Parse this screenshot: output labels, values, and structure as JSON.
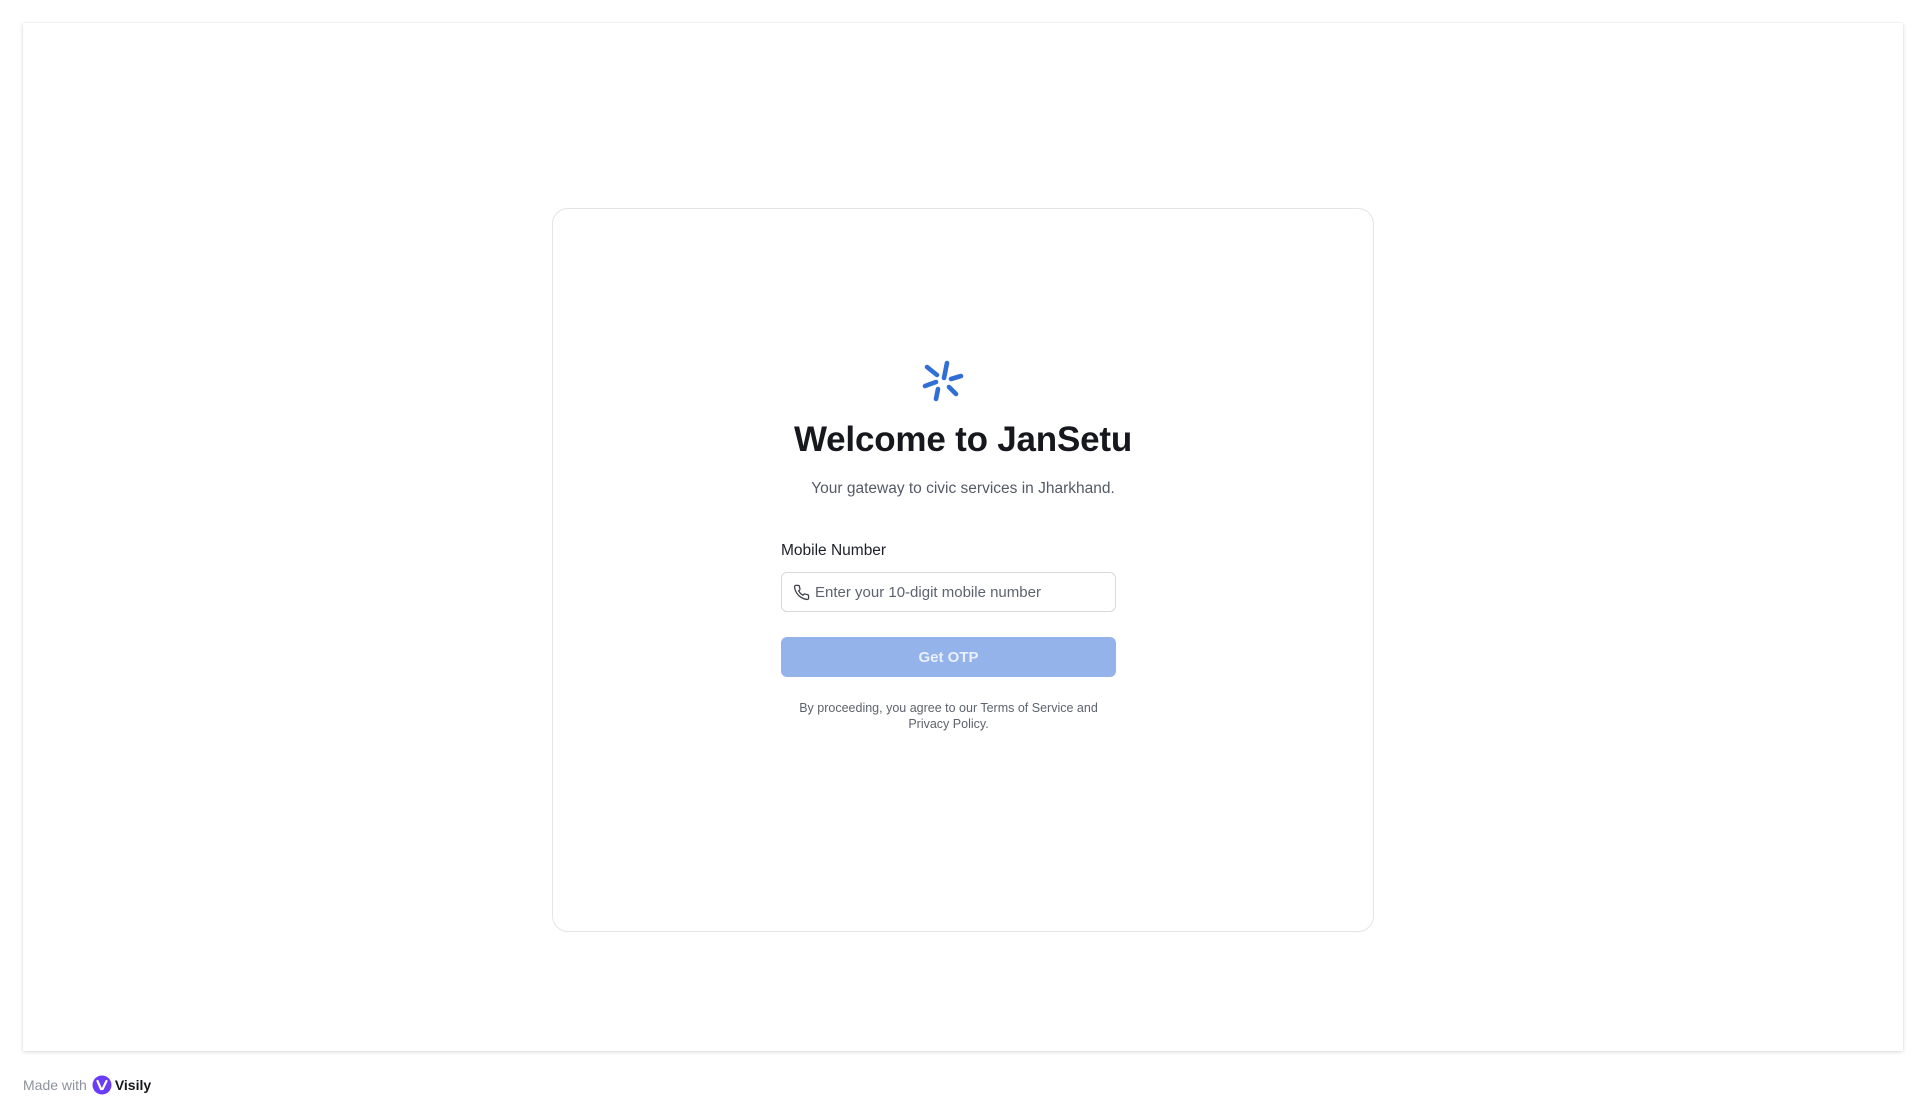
{
  "app": {
    "title": "Welcome to JanSetu",
    "subtitle": "Your gateway to civic services in Jharkhand.",
    "logo_icon": "sparkle-asterisk-icon",
    "accent_color": "#2f6fd6"
  },
  "form": {
    "mobile_label": "Mobile Number",
    "mobile_placeholder": "Enter your 10-digit mobile number",
    "mobile_value": "",
    "phone_icon": "phone-icon",
    "submit_label": "Get OTP",
    "submit_state": "disabled",
    "submit_color": "#94b3ea"
  },
  "terms": {
    "text": "By proceeding, you agree to our Terms of Service and Privacy Policy."
  },
  "footer": {
    "made_with": "Made with",
    "brand": "Visily",
    "brand_icon": "visily-logo-icon",
    "brand_color": "#6b3cf5"
  }
}
